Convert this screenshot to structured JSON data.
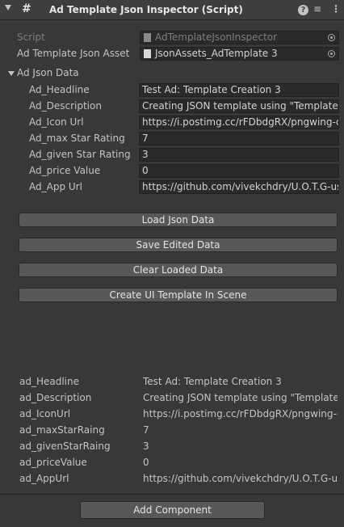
{
  "header": {
    "title": "Ad Template Json Inspector (Script)",
    "script_icon": "#",
    "help_icon": "?",
    "preset_icon": "≡",
    "menu_icon": "⋮"
  },
  "script_row": {
    "label": "Script",
    "value": "AdTemplateJsonInspector"
  },
  "asset_row": {
    "label": "Ad Template Json Asset",
    "value": "JsonAssets_AdTemplate 3"
  },
  "section": {
    "label": "Ad Json Data",
    "fields": [
      {
        "label": "Ad_Headline",
        "value": "Test Ad: Template Creation 3"
      },
      {
        "label": "Ad_Description",
        "value": "Creating JSON template using \"TemplateCr"
      },
      {
        "label": "Ad_Icon Url",
        "value": "https://i.postimg.cc/rFDbdgRX/pngwing-cor"
      },
      {
        "label": "Ad_max Star Rating",
        "value": "7"
      },
      {
        "label": "Ad_given Star Rating",
        "value": "3"
      },
      {
        "label": "Ad_price Value",
        "value": "0"
      },
      {
        "label": "Ad_App Url",
        "value": "https://github.com/vivekchdry/U.O.T.G-usin"
      }
    ]
  },
  "buttons": {
    "load": "Load Json Data",
    "save": "Save Edited Data",
    "clear": "Clear Loaded Data",
    "create": "Create UI Template In Scene"
  },
  "output": [
    {
      "label": "ad_Headline",
      "value": "Test Ad: Template Creation 3"
    },
    {
      "label": "ad_Description",
      "value": "Creating JSON template using \"TemplateCr"
    },
    {
      "label": "ad_IconUrl",
      "value": "https://i.postimg.cc/rFDbdgRX/pngwing-cor"
    },
    {
      "label": "ad_maxStarRaing",
      "value": "7"
    },
    {
      "label": "ad_givenStarRaing",
      "value": "3"
    },
    {
      "label": "ad_priceValue",
      "value": "0"
    },
    {
      "label": "ad_AppUrl",
      "value": "https://github.com/vivekchdry/U.O.T.G-usin"
    }
  ],
  "footer": {
    "add_component": "Add Component"
  }
}
